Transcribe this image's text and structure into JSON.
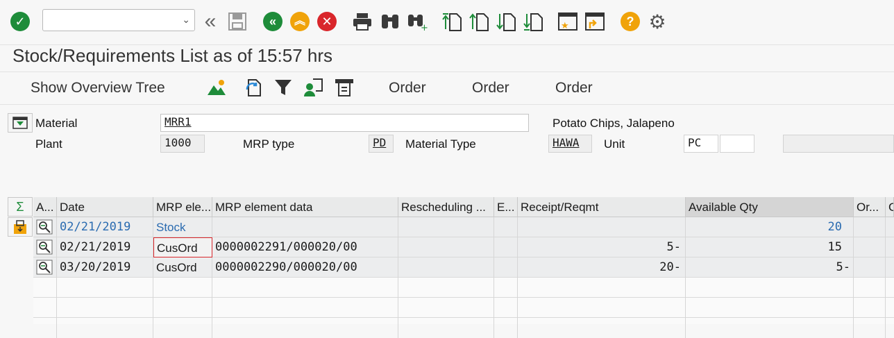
{
  "toolbar": {
    "command_value": "",
    "icons": [
      "check-icon",
      "back-double-icon",
      "save-icon",
      "exit-icon",
      "up-icon",
      "cancel-icon",
      "print-icon",
      "find-icon",
      "find-next-icon",
      "first-page-icon",
      "prev-page-icon",
      "next-page-icon",
      "last-page-icon",
      "new-session-icon",
      "shortcut-icon",
      "help-icon",
      "settings-icon"
    ]
  },
  "title": "Stock/Requirements List as of 15:57 hrs",
  "app_toolbar": {
    "overview_tree": "Show Overview Tree",
    "order1": "Order",
    "order2": "Order",
    "order3": "Order"
  },
  "header": {
    "material_label": "Material",
    "material_value": "MRR1",
    "material_desc": "Potato Chips, Jalapeno",
    "plant_label": "Plant",
    "plant_value": "1000",
    "mrp_type_label": "MRP type",
    "mrp_type_value": "PD",
    "material_type_label": "Material Type",
    "material_type_value": "HAWA",
    "unit_label": "Unit",
    "unit_value": "PC",
    "unit_extra": ""
  },
  "table": {
    "columns": {
      "a": "A...",
      "date": "Date",
      "mrp_el": "MRP ele...",
      "mrp_data": "MRP element data",
      "resched": "Rescheduling ...",
      "e": "E...",
      "receipt": "Receipt/Reqmt",
      "avail": "Available Qty",
      "or": "Or...",
      "c": "C"
    },
    "rows": [
      {
        "date": "02/21/2019",
        "mrp_el": "Stock",
        "mrp_data": "",
        "resched": "",
        "e": "",
        "receipt": "",
        "avail": "20"
      },
      {
        "date": "02/21/2019",
        "mrp_el": "CusOrd",
        "mrp_data": "0000002291/000020/00",
        "resched": "",
        "e": "",
        "receipt": "5-",
        "avail": "15"
      },
      {
        "date": "03/20/2019",
        "mrp_el": "CusOrd",
        "mrp_data": "0000002290/000020/00",
        "resched": "",
        "e": "",
        "receipt": "20-",
        "avail": "5-"
      }
    ]
  },
  "colors": {
    "green": "#1e8c3a",
    "orange": "#f0a30a",
    "red": "#d9262b",
    "link_blue": "#2a6bb0"
  }
}
